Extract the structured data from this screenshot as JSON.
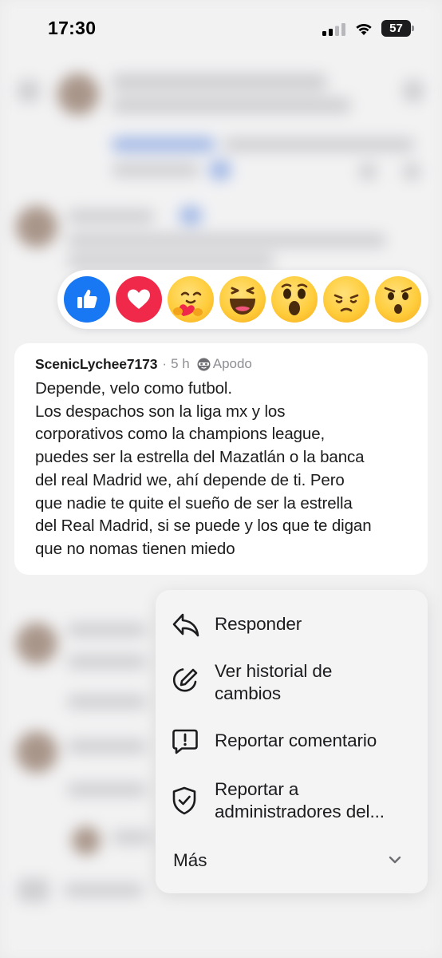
{
  "status_bar": {
    "time": "17:30",
    "battery": "57"
  },
  "reactions": [
    {
      "name": "like",
      "icon": "thumbs-up-icon"
    },
    {
      "name": "love",
      "icon": "heart-icon"
    },
    {
      "name": "care",
      "icon": "hug-face-icon"
    },
    {
      "name": "haha",
      "icon": "laughing-face-icon"
    },
    {
      "name": "wow",
      "icon": "surprised-face-icon"
    },
    {
      "name": "sad",
      "icon": "sad-face-icon"
    },
    {
      "name": "hmm",
      "icon": "skeptical-face-icon"
    }
  ],
  "comment": {
    "author": "ScenicLychee7173",
    "separator": "·",
    "time": "5 h",
    "alias": "Apodo",
    "body": "Depende, velo como futbol.\nLos despachos son la liga mx y los\ncorporativos como la champions league,\npuedes ser la estrella del Mazatlán o la banca\ndel real Madrid we, ahí depende de ti. Pero\nque nadie te quite el sueño de ser la estrella\ndel Real Madrid, si se puede y los que te digan\nque no nomas tienen miedo"
  },
  "menu": {
    "reply": "Responder",
    "history": "Ver historial de\ncambios",
    "report_comment": "Reportar comentario",
    "report_admins": "Reportar a\nadministradores del...",
    "more": "Más"
  },
  "colors": {
    "like_blue": "#1877f2",
    "love_red": "#f02849",
    "reaction_yellow": "#ffcd3c",
    "menu_bg": "#f4f4f5",
    "card_bg": "#ffffff"
  }
}
